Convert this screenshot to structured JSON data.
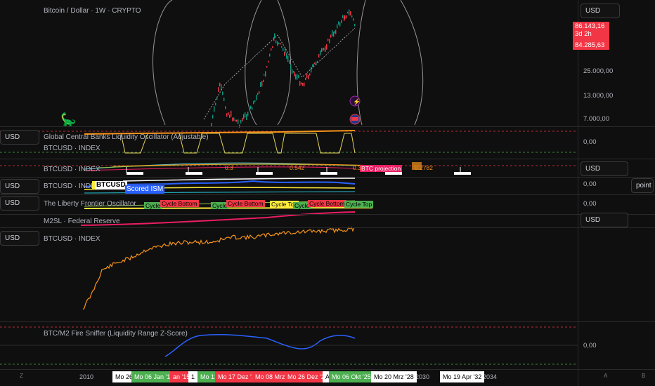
{
  "symbol_title": "Bitcoin / Dollar · 1W · CRYPTO",
  "currency_label": "USD",
  "price_tags": {
    "last": "86.143,16",
    "countdown": "3d 2h",
    "secondary": "84.285,63"
  },
  "price_axis": [
    "25.000,00",
    "13.000,00",
    "7.000,00"
  ],
  "panes": {
    "liquidity_oscillator": {
      "title": "Global Central Banks Liquidity Oscillator (Adjustable)",
      "subtitle": "BTCUSD · INDEX",
      "axis_value": "0,00"
    },
    "cycle_pane": {
      "title": "BTCUSD · INDEX",
      "projection_label": "BTC projection",
      "small_values": [
        "0.3",
        "0.542",
        "0.3",
        "0.2782"
      ]
    },
    "ism_pane": {
      "title": "BTCUSD · INDEX",
      "symbol_chip": "BTCUSD",
      "series_chip": "Scored ISM",
      "axis_value": "0,00",
      "point_button": "point"
    },
    "liberty_pane": {
      "title": "The Liberty Frontier Oscillator",
      "axis_value": "0,00",
      "labels": [
        "Cycle",
        "Cycle Bottom",
        "Cycle",
        "Cycle Bottom",
        "Cycle Top",
        "Cycle",
        "Cycle Bottom",
        "Cycle Top"
      ]
    },
    "m2_pane": {
      "title": "M2SL · Federal Reserve"
    },
    "btc_index_pane": {
      "title": "BTCUSD · INDEX"
    },
    "fire_sniffer": {
      "title": "BTC/M2 Fire Sniffer (Liquidity Range Z-Score)",
      "axis_value": "0,00"
    }
  },
  "time_axis": {
    "years": [
      "2010",
      "2030",
      "2034"
    ],
    "labels": [
      {
        "text": "Mo 26",
        "style": "white"
      },
      {
        "text": "Mo 06 Jan '14",
        "style": "green"
      },
      {
        "text": "an '15",
        "style": "red"
      },
      {
        "text": "1",
        "style": "white"
      },
      {
        "text": "Mo 13",
        "style": "green"
      },
      {
        "text": "Mo 17 Dez '18",
        "style": "red"
      },
      {
        "text": "Mo 08 Mrz",
        "style": "red"
      },
      {
        "text": "Mo 26 Dez '22",
        "style": "red"
      },
      {
        "text": "A",
        "style": "white"
      },
      {
        "text": "Mo 06 Okt '25",
        "style": "green"
      },
      {
        "text": "Mo 20 Mrz '28",
        "style": "white"
      },
      {
        "text": "Mo 19 Apr '32",
        "style": "white"
      }
    ]
  },
  "corner_letters": {
    "left": "Z",
    "right_a": "A",
    "right_b": "B"
  },
  "colors": {
    "up": "#089981",
    "down": "#f23645",
    "orange": "#f7931a",
    "blue": "#2962ff",
    "pink": "#e91e63",
    "yellow": "#ffeb3b"
  }
}
